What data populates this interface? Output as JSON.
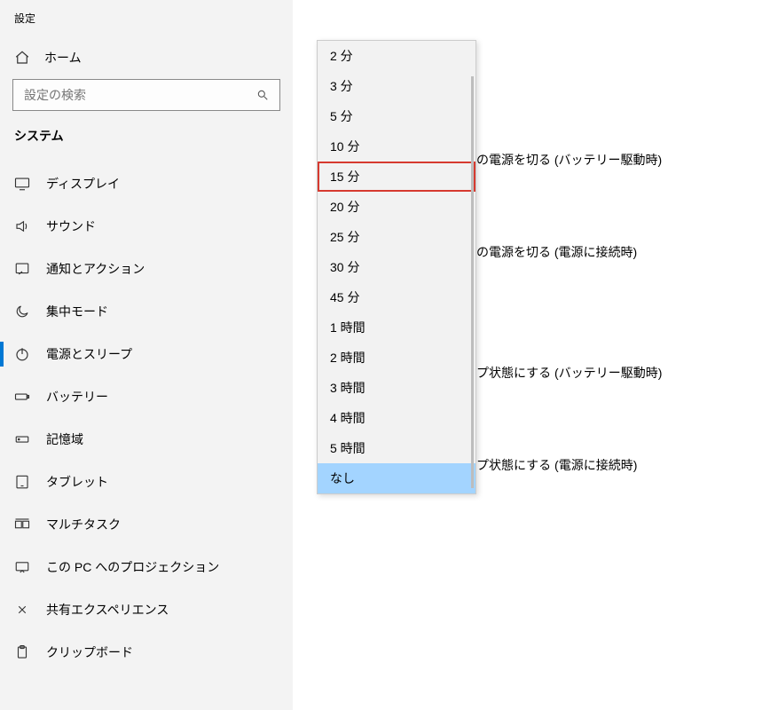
{
  "app": {
    "title": "設定"
  },
  "home": {
    "label": "ホーム"
  },
  "search": {
    "placeholder": "設定の検索"
  },
  "category": {
    "label": "システム"
  },
  "nav": {
    "items": [
      {
        "label": "ディスプレイ"
      },
      {
        "label": "サウンド"
      },
      {
        "label": "通知とアクション"
      },
      {
        "label": "集中モード"
      },
      {
        "label": "電源とスリープ"
      },
      {
        "label": "バッテリー"
      },
      {
        "label": "記憶域"
      },
      {
        "label": "タブレット"
      },
      {
        "label": "マルチタスク"
      },
      {
        "label": "この PC へのプロジェクション"
      },
      {
        "label": "共有エクスペリエンス"
      },
      {
        "label": "クリップボード"
      }
    ]
  },
  "settings": {
    "items": [
      {
        "label": "の電源を切る (バッテリー駆動時)"
      },
      {
        "label": "の電源を切る (電源に接続時)"
      },
      {
        "label": "プ状態にする (バッテリー駆動時)"
      },
      {
        "label": "プ状態にする (電源に接続時)"
      }
    ]
  },
  "dropdown": {
    "options": [
      "2 分",
      "3 分",
      "5 分",
      "10 分",
      "15 分",
      "20 分",
      "25 分",
      "30 分",
      "45 分",
      "1 時間",
      "2 時間",
      "3 時間",
      "4 時間",
      "5 時間",
      "なし"
    ],
    "highlighted_index": 4,
    "selected_index": 14
  }
}
